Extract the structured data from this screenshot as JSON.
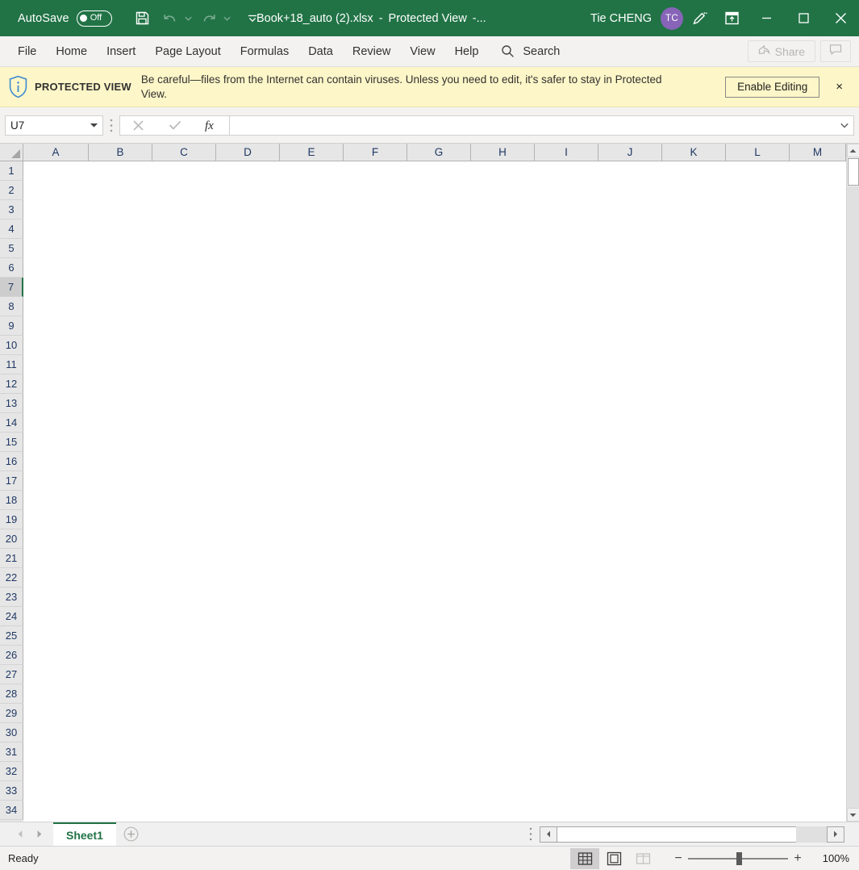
{
  "titlebar": {
    "autosave_label": "AutoSave",
    "autosave_state": "Off",
    "save_icon": "save-icon",
    "undo_icon": "undo-icon",
    "redo_icon": "redo-icon",
    "customize_qat_icon": "chevron-down-icon",
    "document_name": "Book+18_auto (2).xlsx",
    "separator": "-",
    "mode_label": "Protected View",
    "mode_suffix": "-...",
    "user_name": "Tie CHENG",
    "avatar_initials": "TC",
    "avatar_color": "#8764B8",
    "brand_color": "#217346",
    "ink_icon": "pen-ink-icon",
    "ribbon_display_icon": "ribbon-display-options-icon",
    "minimize_icon": "minimize-icon",
    "maximize_icon": "maximize-icon",
    "close_icon": "close-icon"
  },
  "ribbon": {
    "tabs": [
      {
        "label": "File"
      },
      {
        "label": "Home"
      },
      {
        "label": "Insert"
      },
      {
        "label": "Page Layout"
      },
      {
        "label": "Formulas"
      },
      {
        "label": "Data"
      },
      {
        "label": "Review"
      },
      {
        "label": "View"
      },
      {
        "label": "Help"
      }
    ],
    "search_label": "Search",
    "search_icon": "search-icon",
    "share_label": "Share",
    "share_icon": "share-icon",
    "comment_icon": "comment-icon"
  },
  "protected_view": {
    "shield_icon": "info-shield-icon",
    "title": "PROTECTED VIEW",
    "message": "Be careful—files from the Internet can contain viruses. Unless you need to edit, it's safer to stay in Protected View.",
    "enable_label": "Enable Editing",
    "close_label": "×",
    "background_color": "#fdf6c8"
  },
  "formula_bar": {
    "name_box_value": "U7",
    "name_box_chevron_icon": "chevron-down-icon",
    "grip_icon": "vertical-grip-icon",
    "cancel_icon": "cancel-x-icon",
    "enter_icon": "enter-check-icon",
    "function_icon": "insert-function-fx-icon",
    "formula_value": "",
    "expand_icon": "chevron-down-icon"
  },
  "grid": {
    "select_all_icon": "select-all-corner-icon",
    "columns": [
      "A",
      "B",
      "C",
      "D",
      "E",
      "F",
      "G",
      "H",
      "I",
      "J",
      "K",
      "L",
      "M"
    ],
    "rows": [
      1,
      2,
      3,
      4,
      5,
      6,
      7,
      8,
      9,
      10,
      11,
      12,
      13,
      14,
      15,
      16,
      17,
      18,
      19,
      20,
      21,
      22,
      23,
      24,
      25,
      26,
      27,
      28,
      29,
      30,
      31,
      32,
      33,
      34
    ],
    "selected_row": 7,
    "selected_cell": "U7",
    "vscroll_up_icon": "scroll-up-arrow-icon",
    "vscroll_down_icon": "scroll-down-arrow-icon"
  },
  "tabbar": {
    "prev_icon": "previous-sheet-arrow-icon",
    "next_icon": "next-sheet-arrow-icon",
    "sheets": [
      {
        "label": "Sheet1",
        "active": true
      }
    ],
    "add_sheet_icon": "add-sheet-plus-icon",
    "grip_icon": "horizontal-grip-icon",
    "hscroll_left_icon": "scroll-left-arrow-icon",
    "hscroll_right_icon": "scroll-right-arrow-icon"
  },
  "statusbar": {
    "status_text": "Ready",
    "views": [
      {
        "name": "normal-view",
        "icon": "normal-view-icon",
        "active": true
      },
      {
        "name": "page-layout-view",
        "icon": "page-layout-view-icon",
        "active": false
      },
      {
        "name": "page-break-preview",
        "icon": "page-break-preview-icon",
        "active": false
      }
    ],
    "zoom_out_label": "−",
    "zoom_in_label": "+",
    "zoom_level": "100%"
  }
}
